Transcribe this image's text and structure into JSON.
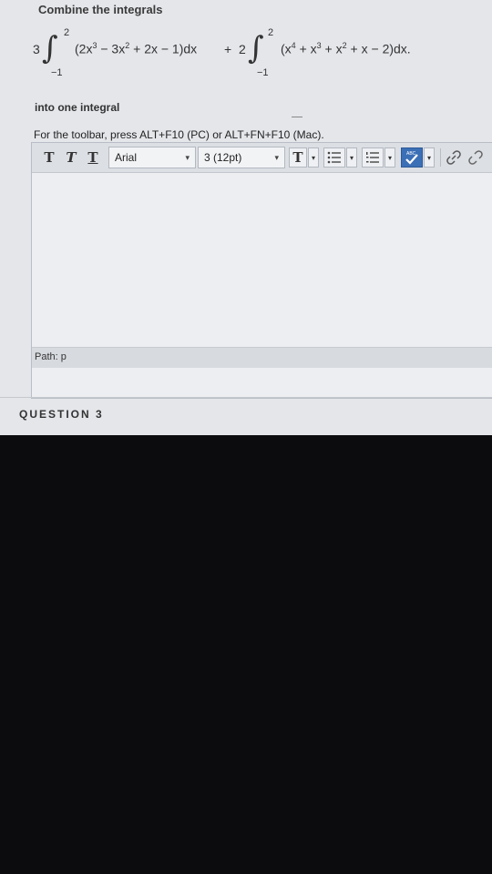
{
  "prompt": {
    "title": "Combine the integrals",
    "coef1": "3",
    "int1_upper": "2",
    "int1_lower": "−1",
    "int1_expr_html": "(2x<sup>3</sup> − 3x<sup>2</sup> + 2x − 1)dx",
    "plus": "+",
    "coef2": "2",
    "int2_upper": "2",
    "int2_lower": "−1",
    "int2_expr_html": "(x<sup>4</sup> + x<sup>3</sup> + x<sup>2</sup> + x − 2)dx.",
    "integral_symbol": "∫",
    "after": "into one integral"
  },
  "editor": {
    "hint": "For the toolbar, press ALT+F10 (PC) or ALT+FN+F10 (Mac).",
    "toolbar": {
      "bold": "T",
      "italic": "T",
      "underline": "T",
      "font_family": "Arial",
      "font_size": "3 (12pt)",
      "text_color": "T",
      "dropdown_arrow": "▾",
      "bullet_list_icon": "bullet-list-icon",
      "numbered_list_icon": "numbered-list-icon",
      "spellcheck_icon": "spellcheck-icon",
      "spellcheck_label": "ABC",
      "link_icon": "link-icon",
      "unlink_icon": "unlink-icon"
    },
    "content": "",
    "path_label": "Path: p"
  },
  "next_question": "QUESTION 3"
}
